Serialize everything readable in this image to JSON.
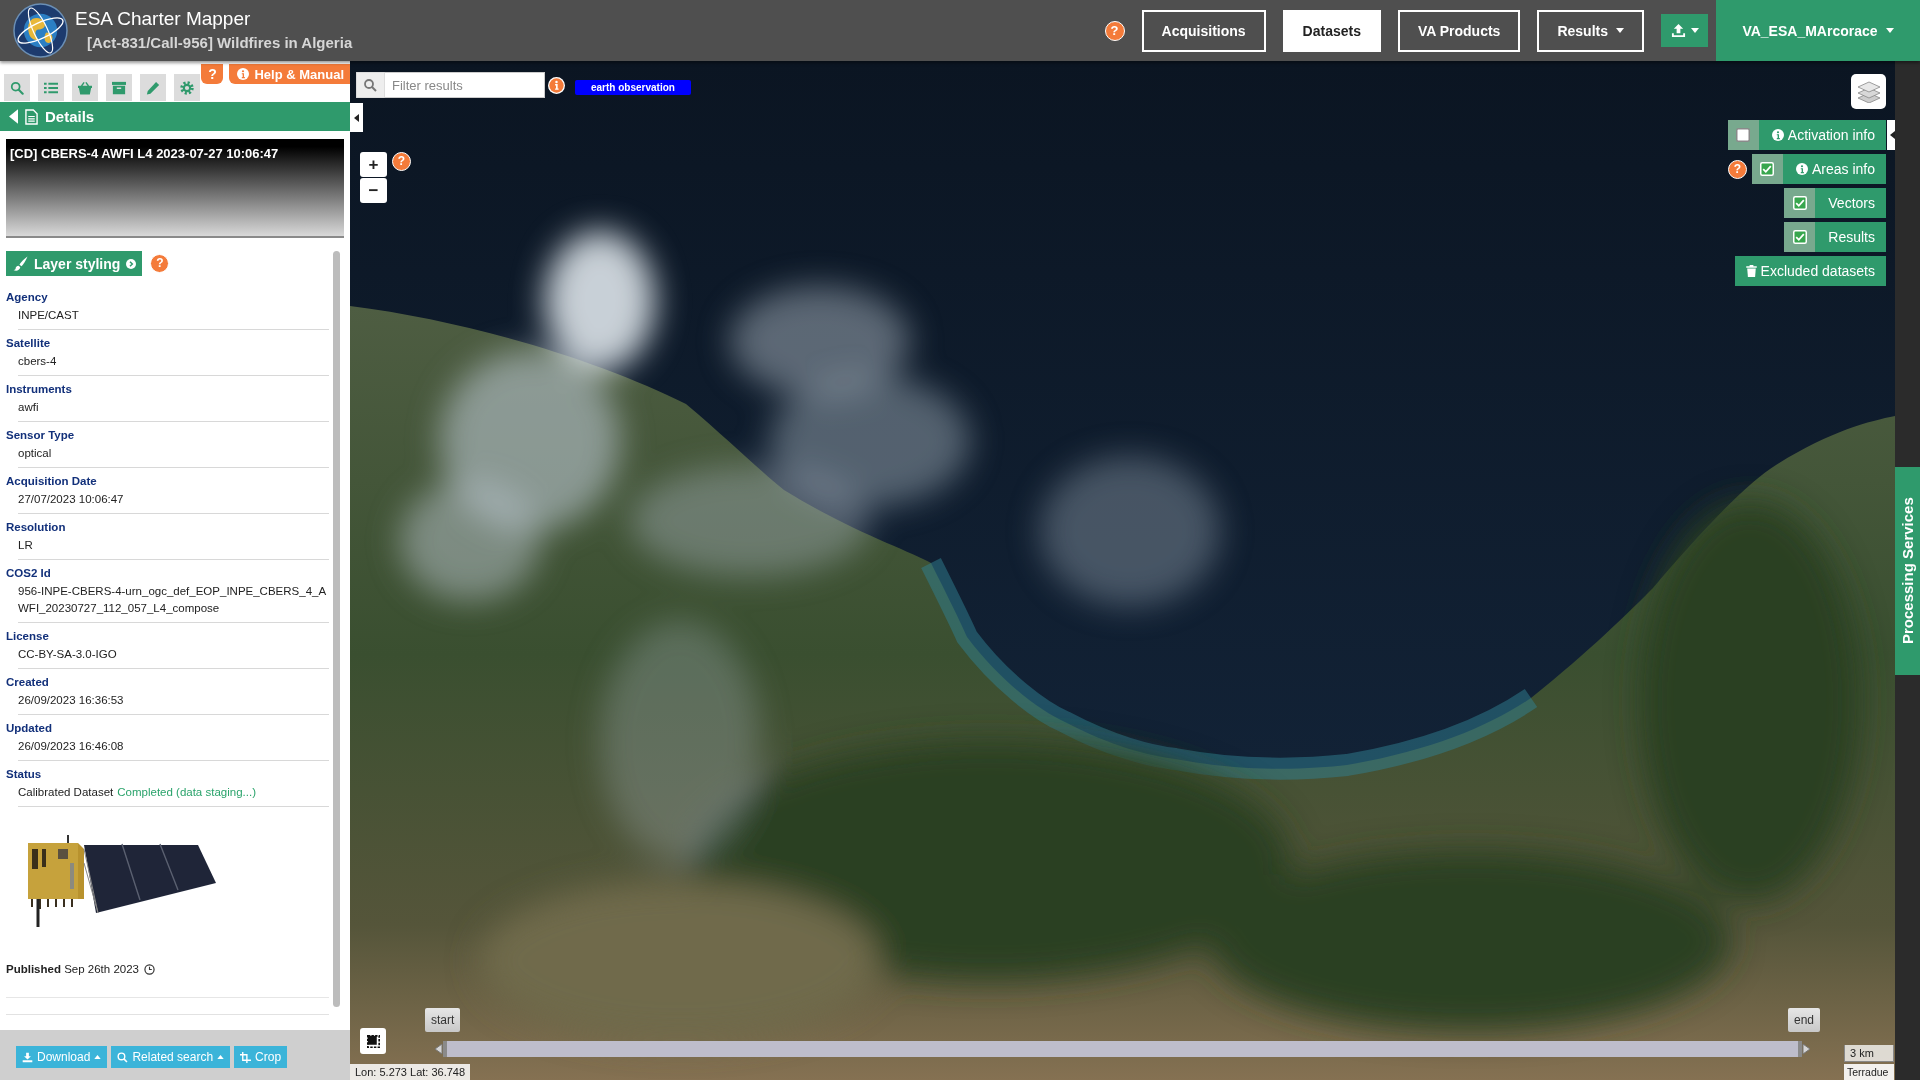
{
  "header": {
    "title": "ESA Charter Mapper",
    "subtitle": "[Act-831/Call-956] Wildfires in Algeria",
    "help": "?",
    "nav": [
      {
        "label": "Acquisitions",
        "selected": false,
        "dropdown": false
      },
      {
        "label": "Datasets",
        "selected": true,
        "dropdown": false
      },
      {
        "label": "VA Products",
        "selected": false,
        "dropdown": false
      },
      {
        "label": "Results",
        "selected": false,
        "dropdown": true
      }
    ],
    "user": "VA_ESA_MArcorace"
  },
  "sidebar": {
    "help": "?",
    "manual": "Help & Manual",
    "panel_title": "Details",
    "dataset_title": "[CD] CBERS-4 AWFI L4 2023-07-27 10:06:47",
    "layer_styling": "Layer styling",
    "layer_help": "?",
    "fields": [
      {
        "label": "Agency",
        "value": "INPE/CAST"
      },
      {
        "label": "Satellite",
        "value": "cbers-4"
      },
      {
        "label": "Instruments",
        "value": "awfi"
      },
      {
        "label": "Sensor Type",
        "value": "optical"
      },
      {
        "label": "Acquisition Date",
        "value": "27/07/2023 10:06:47"
      },
      {
        "label": "Resolution",
        "value": "LR"
      },
      {
        "label": "COS2 Id",
        "value": "956-INPE-CBERS-4-urn_ogc_def_EOP_INPE_CBERS_4_AWFI_20230727_112_057_L4_compose"
      },
      {
        "label": "License",
        "value": "CC-BY-SA-3.0-IGO"
      },
      {
        "label": "Created",
        "value": "26/09/2023 16:36:53"
      },
      {
        "label": "Updated",
        "value": "26/09/2023 16:46:08"
      },
      {
        "label": "Status",
        "value": "Calibrated Dataset",
        "status": "Completed (data staging...)"
      }
    ],
    "published": "**Published** Sep 26th 2023",
    "actions": [
      {
        "kind": "download",
        "label": "Download",
        "dropdown": true
      },
      {
        "kind": "search",
        "label": "Related search",
        "dropdown": true
      },
      {
        "kind": "crop",
        "label": "Crop",
        "dropdown": false
      }
    ]
  },
  "map": {
    "filter_placeholder": "Filter results",
    "tag": "earth observation",
    "zoom_in": "+",
    "zoom_out": "−",
    "help": "?",
    "toggles": [
      {
        "kind": "info",
        "label": "Activation info",
        "checked": false
      },
      {
        "kind": "info",
        "label": "Areas info",
        "checked": true,
        "help": "?"
      },
      {
        "kind": "layer",
        "label": "Vectors",
        "checked": true
      },
      {
        "kind": "layer",
        "label": "Results",
        "checked": true
      }
    ],
    "excluded": "Excluded datasets",
    "timeline": {
      "start": "start",
      "end": "end"
    },
    "coordinates": "Lon: 5.273 Lat: 36.748",
    "scale": "3 km",
    "attribution": "Terradue"
  },
  "side_tab": "Processing Services"
}
